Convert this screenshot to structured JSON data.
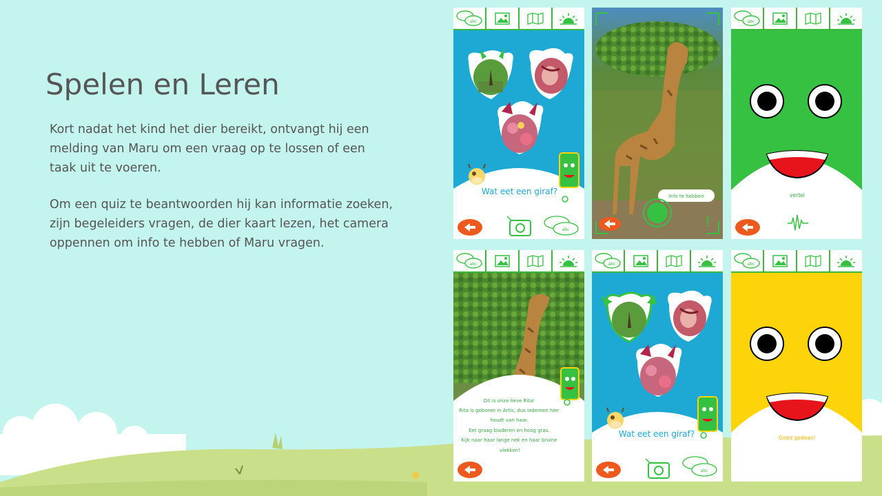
{
  "slide": {
    "title": "Spelen en Leren",
    "paragraph1": "Kort nadat het kind het dier bereikt, ontvangt hij een melding van Maru om een vraag op te lossen of een taak uit te voeren.",
    "paragraph2": "Om een quiz te beantwoorden hij kan informatie zoeken, zijn begeleiders vragen, de dier kaart lezen, het camera oppennen om info te hebben of Maru vragen."
  },
  "phones": {
    "toolbar_icons": [
      "chat-bubbles-icon",
      "image-icon",
      "map-icon",
      "sunrise-icon"
    ],
    "chat_bubble_text": "abc",
    "quiz_question": "Wat eet een giraf?",
    "camera_prompt": "Info te hebben",
    "talk_label": "vertel",
    "success_label": "Goed gedaan!",
    "info_text": [
      "Dit is onze lieve Rita!",
      "Rita is geboren in Artis, dus iedereen hier",
      "houdt van haar.",
      "Eet graag bladeren en hoog gras.",
      "Kijk naar haar lange nek en haar bruine",
      "vlekken!"
    ]
  },
  "colors": {
    "background": "#c4f4ee",
    "accent_green": "#37c143",
    "screen_blue": "#1ea8d4",
    "screen_yellow": "#fdd30a",
    "back_orange": "#ee5a1e",
    "mouth_red": "#e8141c",
    "grass": "#cadf8a"
  }
}
